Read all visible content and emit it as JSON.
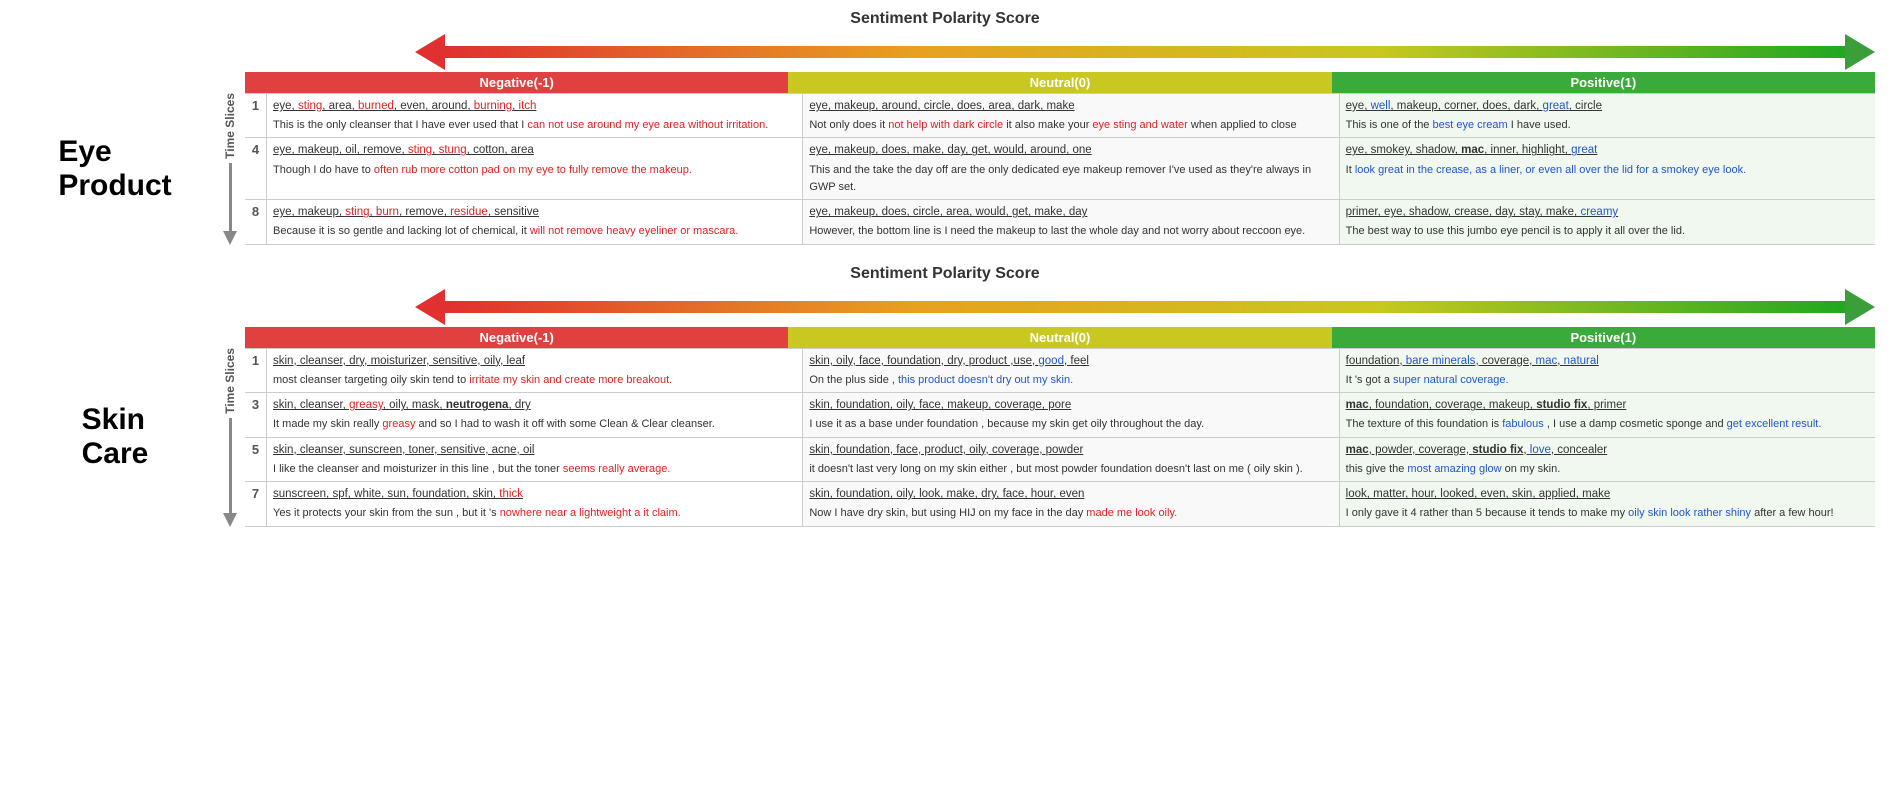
{
  "sections": [
    {
      "title": "Sentiment Polarity Score",
      "side_label": "Eye\nProduct",
      "headers": [
        "Negative(-1)",
        "Neutral(0)",
        "Positive(1)"
      ],
      "rows": [
        {
          "slice": "1",
          "neg_keywords": "eye, sting, area, burned, even, around, burning, itch",
          "neg_keyword_parts": [
            {
              "text": "eye, ",
              "style": ""
            },
            {
              "text": "sting",
              "style": "red"
            },
            {
              "text": ", area, ",
              "style": ""
            },
            {
              "text": "burned",
              "style": "red"
            },
            {
              "text": ", even, around, ",
              "style": ""
            },
            {
              "text": "burning",
              "style": "red"
            },
            {
              "text": ", ",
              "style": ""
            },
            {
              "text": "itch",
              "style": "red"
            }
          ],
          "neg_review": "This is the only cleanser that I have ever used that I can not use around my eye area without irritation.",
          "neg_review_parts": [
            {
              "text": "This is the only cleanser that I have ever used that I ",
              "style": ""
            },
            {
              "text": "can not use around my eye area without irritation.",
              "style": "red"
            }
          ],
          "neu_keywords": "eye, makeup, around, circle, does, area, dark, make",
          "neu_review": "Not only does it not help with dark circle it also make your eye sting and water when applied to close",
          "neu_review_parts": [
            {
              "text": "Not only does it ",
              "style": ""
            },
            {
              "text": "not help with dark circle",
              "style": "red"
            },
            {
              "text": " it also make your ",
              "style": ""
            },
            {
              "text": "eye sting and water",
              "style": "red"
            },
            {
              "text": " when applied to close",
              "style": ""
            }
          ],
          "pos_keywords": "eye, well, makeup, corner, does, dark, great, circle",
          "pos_keyword_parts": [
            {
              "text": "eye, ",
              "style": ""
            },
            {
              "text": "well",
              "style": "blue"
            },
            {
              "text": ", makeup, corner, does, dark, ",
              "style": ""
            },
            {
              "text": "great",
              "style": "blue"
            },
            {
              "text": ", circle",
              "style": ""
            }
          ],
          "pos_review": "This is one of the best eye cream I have used.",
          "pos_review_parts": [
            {
              "text": "This is one of the ",
              "style": ""
            },
            {
              "text": "best eye cream",
              "style": "blue"
            },
            {
              "text": " I have used.",
              "style": ""
            }
          ]
        },
        {
          "slice": "4",
          "neg_keywords": "eye, makeup, oil, remove, sting, stung, cotton, area",
          "neg_review": "Though I do have to often rub more cotton pad on my eye to fully remove the makeup.",
          "neg_review_parts": [
            {
              "text": "Though I do have to ",
              "style": ""
            },
            {
              "text": "often rub more cotton pad on my eye to fully remove the makeup.",
              "style": "red"
            }
          ],
          "neu_keywords": "eye, makeup, does, make, day, get, would, around, one",
          "neu_review": "This and the take the day off are the only dedicated eye makeup remover I've used as they're always in GWP set.",
          "neu_review_parts": [
            {
              "text": "This and the take the day off are the only dedicated eye makeup remover I've used as they're always in GWP set.",
              "style": ""
            }
          ],
          "pos_keywords": "eye, smokey, shadow, mac, inner, highlight, great",
          "pos_keyword_parts": [
            {
              "text": "eye, smokey, shadow, ",
              "style": ""
            },
            {
              "text": "mac",
              "style": "bold"
            },
            {
              "text": ", inner, highlight, ",
              "style": ""
            },
            {
              "text": "great",
              "style": "blue"
            }
          ],
          "pos_review": "It look great in the crease, as a liner, or even all over the lid for a smokey eye look.",
          "pos_review_parts": [
            {
              "text": "It ",
              "style": ""
            },
            {
              "text": "look great in the crease, as a liner, or even all over the lid for a smokey eye look.",
              "style": "blue"
            }
          ]
        },
        {
          "slice": "8",
          "neg_keywords": "eye, makeup, sting, burn, remove, residue, sensitive",
          "neg_keyword_parts": [
            {
              "text": "eye, makeup, ",
              "style": ""
            },
            {
              "text": "sting",
              "style": "red"
            },
            {
              "text": ", ",
              "style": ""
            },
            {
              "text": "burn",
              "style": "red"
            },
            {
              "text": ", remove, ",
              "style": ""
            },
            {
              "text": "residue",
              "style": "red"
            },
            {
              "text": ", sensitive",
              "style": ""
            }
          ],
          "neg_review": "Because it is so gentle and lacking lot of chemical, it will not remove heavy eyeliner or mascara.",
          "neg_review_parts": [
            {
              "text": "Because it is so gentle and lacking lot of chemical, it ",
              "style": ""
            },
            {
              "text": "will not remove heavy eyeliner or mascara.",
              "style": "red"
            }
          ],
          "neu_keywords": "eye, makeup, does, circle, area, would, get, make, day",
          "neu_review": "However, the bottom line is I need the makeup to last the whole day and not worry about reccoon eye.",
          "neu_review_parts": [
            {
              "text": "However, the bottom line is I need the makeup to last the whole day and not worry about reccoon eye.",
              "style": ""
            }
          ],
          "pos_keywords": "primer, eye, shadow, crease, day, stay, make, creamy",
          "pos_keyword_parts": [
            {
              "text": "primer, eye, shadow, crease, day, stay, make, ",
              "style": ""
            },
            {
              "text": "creamy",
              "style": "blue"
            }
          ],
          "pos_review": "The best way to use this jumbo eye pencil is to apply it all over the lid.",
          "pos_review_parts": [
            {
              "text": "The best way to use this jumbo eye pencil is to apply it all over the lid.",
              "style": ""
            }
          ]
        }
      ]
    },
    {
      "title": "Sentiment Polarity Score",
      "side_label": "Skin\nCare",
      "headers": [
        "Negative(-1)",
        "Neutral(0)",
        "Positive(1)"
      ],
      "rows": [
        {
          "slice": "1",
          "neg_keywords": "skin, cleanser, dry, moisturizer, sensitive, oily, leaf",
          "neg_review": "most cleanser targeting oily skin tend to irritate my skin and create more breakout.",
          "neg_review_parts": [
            {
              "text": "most cleanser targeting oily skin tend to ",
              "style": ""
            },
            {
              "text": "irritate my skin and create more breakout.",
              "style": "red"
            }
          ],
          "neu_keywords": "skin, oily, face, foundation, dry, product ,use, good, feel",
          "neu_keyword_parts": [
            {
              "text": "skin, oily, face, foundation, dry, product ,use, ",
              "style": ""
            },
            {
              "text": "good",
              "style": "blue"
            },
            {
              "text": ", feel",
              "style": ""
            }
          ],
          "neu_review": "On the plus side , this product doesn't dry out my skin.",
          "neu_review_parts": [
            {
              "text": "On the plus side , ",
              "style": ""
            },
            {
              "text": "this product doesn't dry out my skin.",
              "style": "blue"
            }
          ],
          "pos_keywords": "foundation, bare minerals, coverage, mac, natural",
          "pos_keyword_parts": [
            {
              "text": "foundation, ",
              "style": ""
            },
            {
              "text": "bare minerals",
              "style": "blue"
            },
            {
              "text": ", coverage, ",
              "style": ""
            },
            {
              "text": "mac",
              "style": "blue"
            },
            {
              "text": ", ",
              "style": ""
            },
            {
              "text": "natural",
              "style": "blue"
            }
          ],
          "pos_review": "It 's got a super natural coverage.",
          "pos_review_parts": [
            {
              "text": "It 's got a ",
              "style": ""
            },
            {
              "text": "super natural coverage.",
              "style": "blue"
            }
          ]
        },
        {
          "slice": "3",
          "neg_keywords": "skin, cleanser, greasy, oily, mask, neutrogena, dry",
          "neg_keyword_parts": [
            {
              "text": "skin, cleanser, ",
              "style": ""
            },
            {
              "text": "greasy",
              "style": "red"
            },
            {
              "text": ", oily, mask, ",
              "style": ""
            },
            {
              "text": "neutrogena",
              "style": "bold"
            },
            {
              "text": ", dry",
              "style": ""
            }
          ],
          "neg_review": "It made my skin really greasy and so I had to wash it off with some Clean & Clear cleanser.",
          "neg_review_parts": [
            {
              "text": "It made my skin really ",
              "style": ""
            },
            {
              "text": "greasy",
              "style": "red"
            },
            {
              "text": " and so I had to wash it off with some Clean & Clear cleanser.",
              "style": ""
            }
          ],
          "neu_keywords": "skin, foundation, oily, face, makeup, coverage, pore",
          "neu_review": "I use it as a base under foundation , because my skin get oily throughout the day.",
          "neu_review_parts": [
            {
              "text": " I use it as a base under foundation , because my skin get oily throughout the day.",
              "style": ""
            }
          ],
          "pos_keywords": "mac, foundation, coverage, makeup, studio fix, primer",
          "pos_keyword_parts": [
            {
              "text": "mac",
              "style": "bold"
            },
            {
              "text": ", foundation, coverage, makeup, ",
              "style": ""
            },
            {
              "text": "studio fix",
              "style": "bold"
            },
            {
              "text": ", primer",
              "style": ""
            }
          ],
          "pos_review": "The texture of this foundation is fabulous , I use a damp cosmetic sponge and get excellent result.",
          "pos_review_parts": [
            {
              "text": "The texture of this foundation is ",
              "style": ""
            },
            {
              "text": "fabulous",
              "style": "blue"
            },
            {
              "text": " , I use a damp cosmetic sponge and ",
              "style": ""
            },
            {
              "text": "get excellent result.",
              "style": "blue"
            }
          ]
        },
        {
          "slice": "5",
          "neg_keywords": "skin, cleanser, sunscreen, toner, sensitive, acne, oil",
          "neg_review": "I like the cleanser and moisturizer in this line , but the toner seems really average.",
          "neg_review_parts": [
            {
              "text": "I like the cleanser and moisturizer in this line , but the toner ",
              "style": ""
            },
            {
              "text": "seems really average.",
              "style": "red"
            }
          ],
          "neu_keywords": "skin, foundation, face, product, oily, coverage, powder",
          "neu_review": "it doesn't last very long on my skin either , but most powder foundation doesn't last on me ( oily skin ).",
          "neu_review_parts": [
            {
              "text": "it doesn't last very long on my skin either , but most powder foundation doesn't last on me ( oily skin ).",
              "style": ""
            }
          ],
          "pos_keywords": "mac, powder, coverage, studio fix, love, concealer",
          "pos_keyword_parts": [
            {
              "text": "mac",
              "style": "bold"
            },
            {
              "text": ", powder, coverage, ",
              "style": ""
            },
            {
              "text": "studio fix",
              "style": "bold"
            },
            {
              "text": ", ",
              "style": ""
            },
            {
              "text": "love",
              "style": "blue"
            },
            {
              "text": ", concealer",
              "style": ""
            }
          ],
          "pos_review": "this give the most amazing glow on my skin.",
          "pos_review_parts": [
            {
              "text": "this give the ",
              "style": ""
            },
            {
              "text": "most amazing glow",
              "style": "blue"
            },
            {
              "text": " on my skin.",
              "style": ""
            }
          ]
        },
        {
          "slice": "7",
          "neg_keywords": "sunscreen, spf, white, sun, foundation, skin, thick",
          "neg_keyword_parts": [
            {
              "text": "sunscreen, spf, white, sun, foundation, skin, ",
              "style": ""
            },
            {
              "text": "thick",
              "style": "red"
            }
          ],
          "neg_review": "Yes it protects your skin from the sun , but it 's nowhere near a lightweight a it claim.",
          "neg_review_parts": [
            {
              "text": "Yes it protects your skin from the sun , but it 's ",
              "style": ""
            },
            {
              "text": "nowhere near a lightweight a it claim.",
              "style": "red"
            }
          ],
          "neu_keywords": "skin, foundation, oily, look, make, dry, face, hour, even",
          "neu_review": "Now I have dry skin, but using HIJ on my face in the day made me look oily.",
          "neu_review_parts": [
            {
              "text": "Now I have dry skin, but using HIJ on my face in the day ",
              "style": ""
            },
            {
              "text": "made me look oily.",
              "style": "red"
            }
          ],
          "pos_keywords": "look, matter, hour, looked, even, skin, applied, make",
          "pos_review": "I only gave it 4 rather than 5 because it tends to make my oily skin look rather shiny after a few hour!",
          "pos_review_parts": [
            {
              "text": "I only gave it 4 rather than 5 because it tends to make my ",
              "style": ""
            },
            {
              "text": "oily skin look rather shiny",
              "style": "blue"
            },
            {
              "text": " after a few hour!",
              "style": ""
            }
          ]
        }
      ]
    }
  ]
}
